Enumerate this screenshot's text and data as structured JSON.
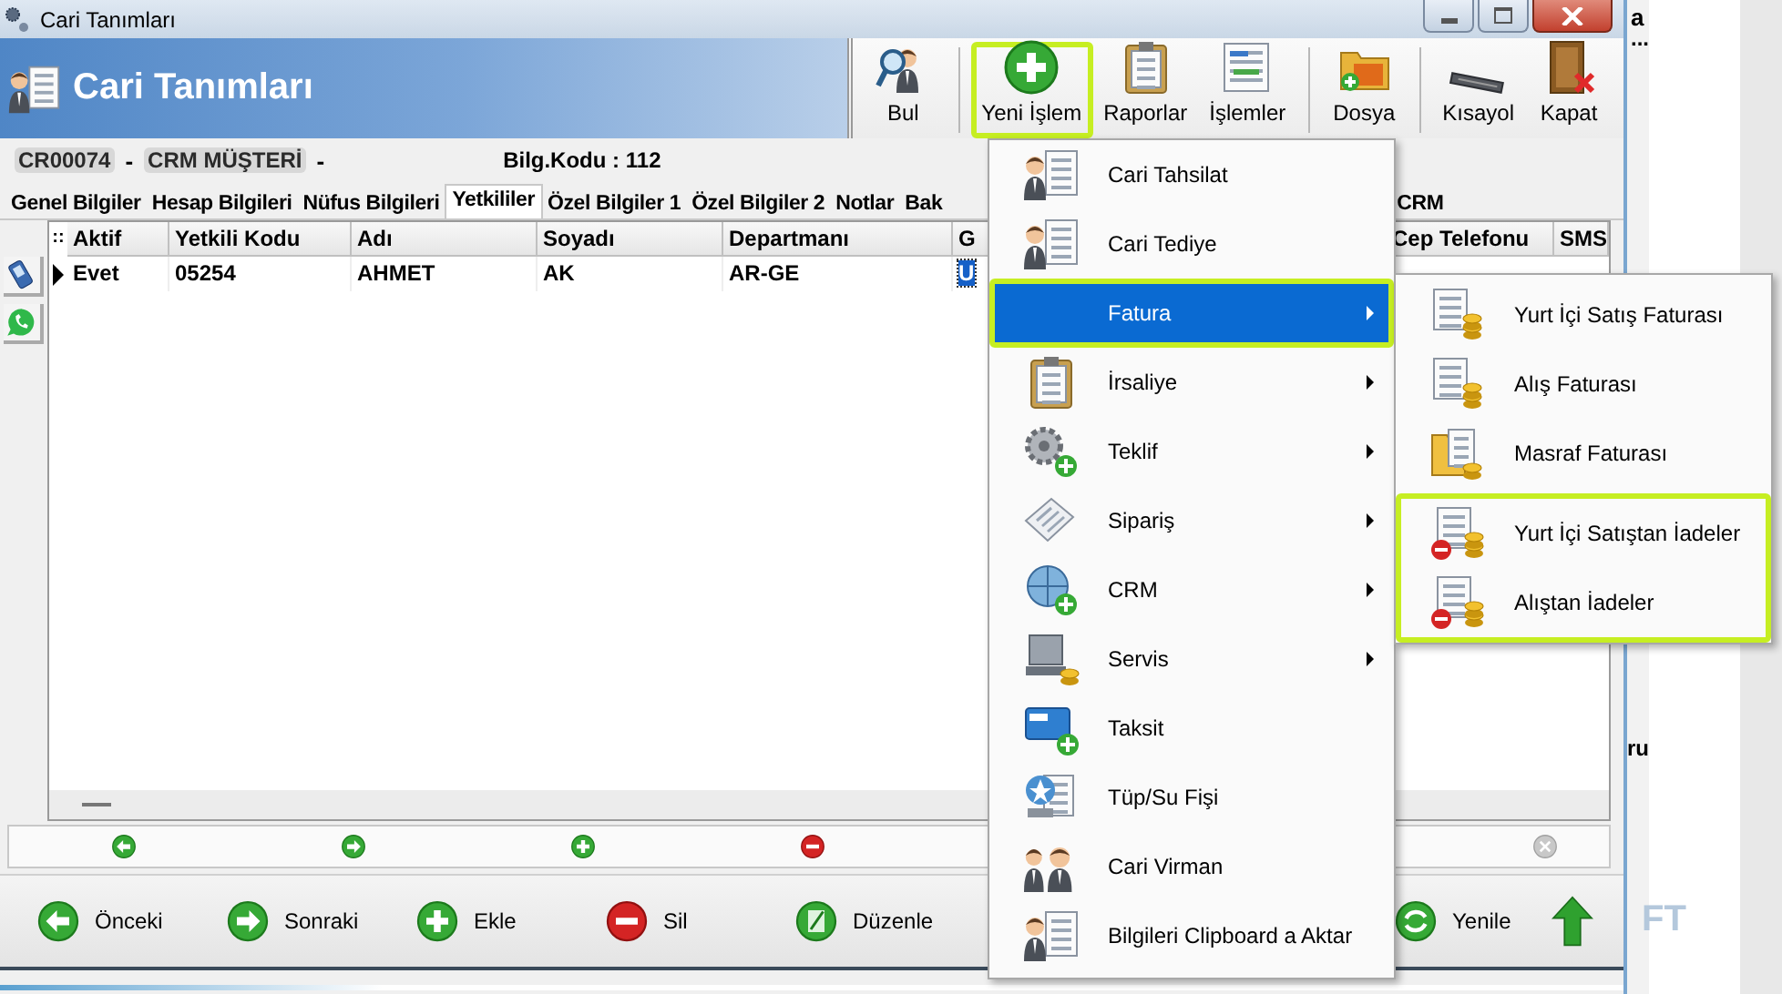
{
  "window": {
    "title": "Cari Tanımları"
  },
  "header": {
    "title": "Cari Tanımları"
  },
  "toolbar": [
    {
      "label": "Bul",
      "highlighted": false
    },
    {
      "label": "Yeni İşlem",
      "highlighted": true
    },
    {
      "label": "Raporlar",
      "highlighted": false
    },
    {
      "label": "İşlemler",
      "highlighted": false
    },
    {
      "label": "Dosya",
      "highlighted": false
    },
    {
      "label": "Kısayol",
      "highlighted": false
    },
    {
      "label": "Kapat",
      "highlighted": false
    }
  ],
  "record": {
    "code": "CR00074",
    "separator_1": "-",
    "name": "CRM MÜŞTERİ",
    "separator_2": "-",
    "info": "Bilg.Kodu : 112"
  },
  "tabs": [
    {
      "label": "Genel Bilgiler",
      "selected": false,
      "kind": "full"
    },
    {
      "label": "Hesap Bilgileri",
      "selected": false,
      "kind": "full"
    },
    {
      "label": "Nüfus Bilgileri",
      "selected": false,
      "kind": "full"
    },
    {
      "label": "Yetkililer",
      "selected": true,
      "kind": "full"
    },
    {
      "label": "Özel Bilgiler 1",
      "selected": false,
      "kind": "full"
    },
    {
      "label": "Özel Bilgiler 2",
      "selected": false,
      "kind": "full"
    },
    {
      "label": "Notlar",
      "selected": false,
      "kind": "full"
    },
    {
      "label": "Bak",
      "selected": false,
      "kind": "partial"
    },
    {
      "label": "CRM",
      "selected": false,
      "kind": "full"
    }
  ],
  "table": {
    "corner": "::",
    "columns": [
      "Aktif",
      "Yetkili Kodu",
      "Adı",
      "Soyadı",
      "Departmanı",
      "G",
      "Cep Telefonu",
      "SMS"
    ],
    "rows": [
      {
        "current": true,
        "cells": [
          {
            "text": "Evet",
            "selected": false
          },
          {
            "text": "05254",
            "selected": false
          },
          {
            "text": "AHMET",
            "selected": false
          },
          {
            "text": "AK",
            "selected": false
          },
          {
            "text": "AR-GE",
            "selected": false
          },
          {
            "text": "U",
            "selected": true
          }
        ]
      }
    ]
  },
  "bottom_buttons": [
    {
      "label": "Önceki"
    },
    {
      "label": "Sonraki"
    },
    {
      "label": "Ekle"
    },
    {
      "label": "Sil"
    },
    {
      "label": "Düzenle"
    },
    {
      "label": "Yenile"
    }
  ],
  "menu": {
    "items": [
      {
        "label": "Cari Tahsilat",
        "has_submenu": false,
        "selected": false,
        "highlighted": false
      },
      {
        "label": "Cari Tediye",
        "has_submenu": false,
        "selected": false,
        "highlighted": false
      },
      {
        "label": "Fatura",
        "has_submenu": true,
        "selected": true,
        "highlighted": true
      },
      {
        "label": "İrsaliye",
        "has_submenu": true,
        "selected": false,
        "highlighted": false
      },
      {
        "label": "Teklif",
        "has_submenu": true,
        "selected": false,
        "highlighted": false
      },
      {
        "label": "Sipariş",
        "has_submenu": true,
        "selected": false,
        "highlighted": false
      },
      {
        "label": "CRM",
        "has_submenu": true,
        "selected": false,
        "highlighted": false
      },
      {
        "label": "Servis",
        "has_submenu": true,
        "selected": false,
        "highlighted": false
      },
      {
        "label": "Taksit",
        "has_submenu": false,
        "selected": false,
        "highlighted": false
      },
      {
        "label": "Tüp/Su Fişi",
        "has_submenu": false,
        "selected": false,
        "highlighted": false
      },
      {
        "label": "Cari Virman",
        "has_submenu": false,
        "selected": false,
        "highlighted": false
      },
      {
        "label": "Bilgileri Clipboard a Aktar",
        "has_submenu": false,
        "selected": false,
        "highlighted": false
      }
    ],
    "submenu": {
      "groups": [
        {
          "highlighted": false,
          "items": [
            "Yurt İçi Satış Faturası",
            "Alış Faturası",
            "Masraf Faturası"
          ]
        },
        {
          "highlighted": true,
          "items": [
            "Yurt İçi Satıştan İadeler",
            "Alıştan İadeler"
          ]
        }
      ]
    }
  },
  "background_window": {
    "line_1": "a",
    "line_2": "...",
    "fragment": "ru",
    "logo_text": "FT"
  }
}
